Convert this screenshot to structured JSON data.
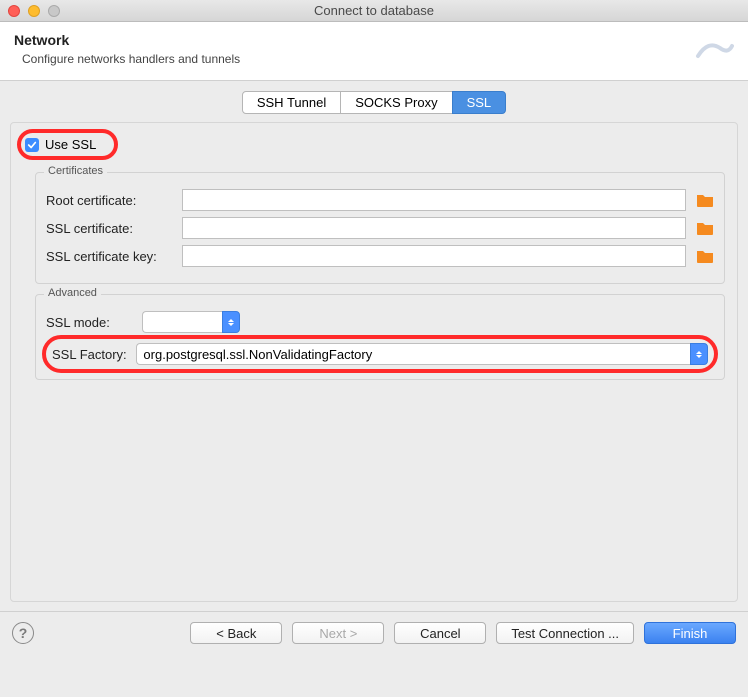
{
  "window": {
    "title": "Connect to database"
  },
  "header": {
    "title": "Network",
    "subtitle": "Configure networks handlers and tunnels"
  },
  "tabs": {
    "items": [
      {
        "label": "SSH Tunnel",
        "active": false
      },
      {
        "label": "SOCKS Proxy",
        "active": false
      },
      {
        "label": "SSL",
        "active": true
      }
    ]
  },
  "ssl": {
    "use_ssl_label": "Use SSL",
    "use_ssl_checked": true,
    "certificates": {
      "legend": "Certificates",
      "root_label": "Root certificate:",
      "root_value": "",
      "cert_label": "SSL certificate:",
      "cert_value": "",
      "key_label": "SSL certificate key:",
      "key_value": ""
    },
    "advanced": {
      "legend": "Advanced",
      "mode_label": "SSL mode:",
      "mode_value": "",
      "factory_label": "SSL Factory:",
      "factory_value": "org.postgresql.ssl.NonValidatingFactory"
    }
  },
  "footer": {
    "back": "< Back",
    "next": "Next >",
    "cancel": "Cancel",
    "test": "Test Connection ...",
    "finish": "Finish"
  },
  "colors": {
    "accent": "#4a90e2",
    "highlight": "#ff2a2a",
    "folder": "#f58a1f"
  }
}
